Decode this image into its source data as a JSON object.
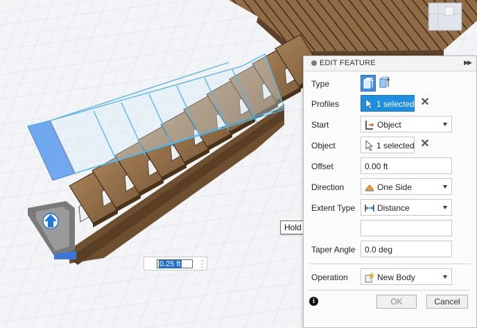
{
  "viewport": {
    "dimension_value": "0.25 ft"
  },
  "tooltip": {
    "text": "Hold Ctrl to modify selection"
  },
  "panel": {
    "title": "EDIT FEATURE",
    "rows": {
      "type": {
        "label": "Type"
      },
      "profiles": {
        "label": "Profiles",
        "value": "1 selected"
      },
      "start": {
        "label": "Start",
        "value": "Object",
        "icon": "start-object-icon"
      },
      "object": {
        "label": "Object",
        "value": "1 selected"
      },
      "offset": {
        "label": "Offset",
        "value": "0.00 ft"
      },
      "direction": {
        "label": "Direction",
        "value": "One Side",
        "icon": "one-side-icon"
      },
      "extent_type": {
        "label": "Extent Type",
        "value": "Distance",
        "icon": "distance-icon"
      },
      "taper_angle": {
        "label": "Taper Angle",
        "value": "0.0 deg"
      },
      "operation": {
        "label": "Operation",
        "value": "New Body",
        "icon": "new-body-icon"
      }
    },
    "footer": {
      "ok_label": "OK",
      "cancel_label": "Cancel"
    }
  },
  "colors": {
    "accent": "#1e8ee0",
    "selection_fill": "#5b9cf0",
    "wood": "#8d6b45",
    "riser": "#e8e8e8"
  }
}
